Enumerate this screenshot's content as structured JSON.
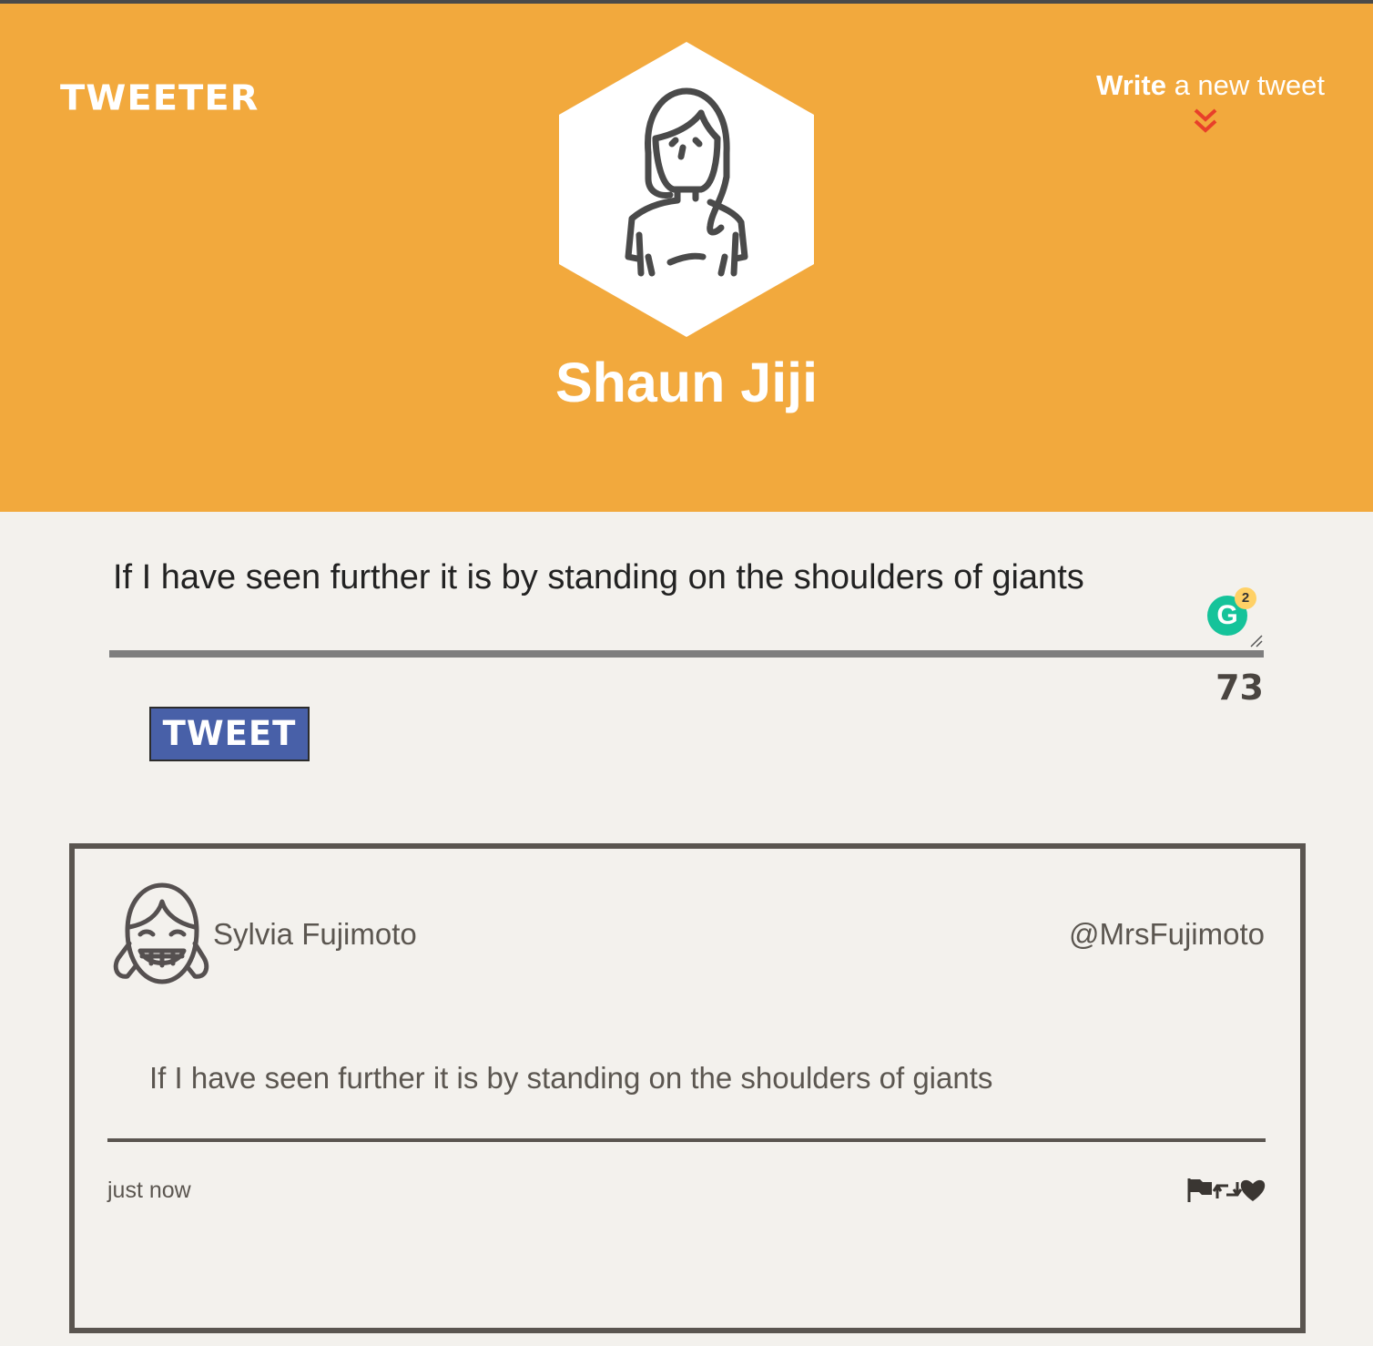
{
  "header": {
    "brand": "TWEETER",
    "write_link_strong": "Write",
    "write_link_rest": " a new tweet",
    "profile_name": "Shaun Jiji"
  },
  "composer": {
    "text": "If I have seen further it is by standing on the shoulders of giants",
    "char_counter": "73",
    "grammarly_badge": "2",
    "tweet_button": "TWEET"
  },
  "tweets": [
    {
      "name": "Sylvia Fujimoto",
      "handle": "@MrsFujimoto",
      "content": "If I have seen further it is by standing on the shoulders of giants",
      "time": "just now",
      "actions": [
        "flag-icon",
        "retweet-icon",
        "heart-icon"
      ]
    }
  ],
  "colors": {
    "header_bg": "#f2a93d",
    "page_bg": "#f3f1ed",
    "tweet_button_bg": "#4860a8",
    "chevron": "#e8402a",
    "grammarly": "#15c39a",
    "text_dark": "#5b5650"
  }
}
